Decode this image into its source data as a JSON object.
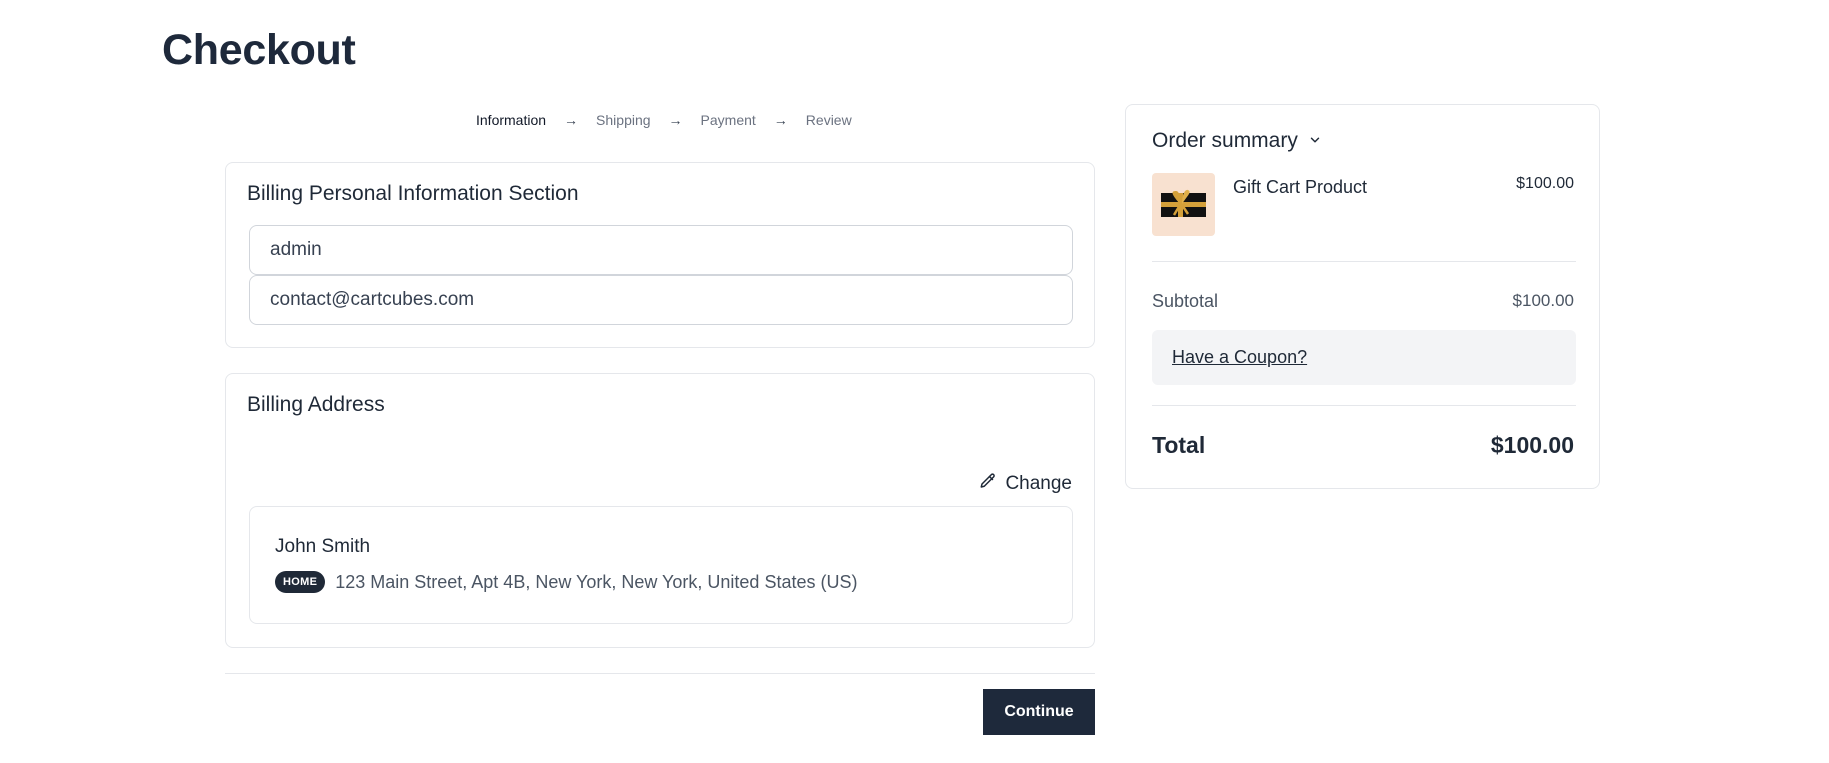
{
  "page": {
    "title": "Checkout"
  },
  "steps": [
    {
      "label": "Information",
      "active": true
    },
    {
      "label": "Shipping",
      "active": false
    },
    {
      "label": "Payment",
      "active": false
    },
    {
      "label": "Review",
      "active": false
    }
  ],
  "step_separator": "→",
  "billing_info": {
    "title": "Billing Personal Information Section",
    "name_value": "admin",
    "email_value": "contact@cartcubes.com"
  },
  "billing_address": {
    "title": "Billing Address",
    "change_label": "Change",
    "name": "John Smith",
    "badge": "HOME",
    "address": "123 Main Street, Apt 4B, New York, New York, United States (US)"
  },
  "actions": {
    "continue_label": "Continue"
  },
  "summary": {
    "title": "Order summary",
    "product": {
      "name": "Gift Cart Product",
      "price": "$100.00",
      "image_icon": "gift-card-icon"
    },
    "subtotal_label": "Subtotal",
    "subtotal_value": "$100.00",
    "coupon_label": "Have a Coupon?",
    "total_label": "Total",
    "total_value": "$100.00"
  },
  "colors": {
    "primary": "#1e293b",
    "border": "#e5e7eb",
    "muted_text": "#4b5563",
    "coupon_bg": "#f3f4f6",
    "product_bg": "#f8e1d0",
    "ribbon": "#d4a03a"
  }
}
